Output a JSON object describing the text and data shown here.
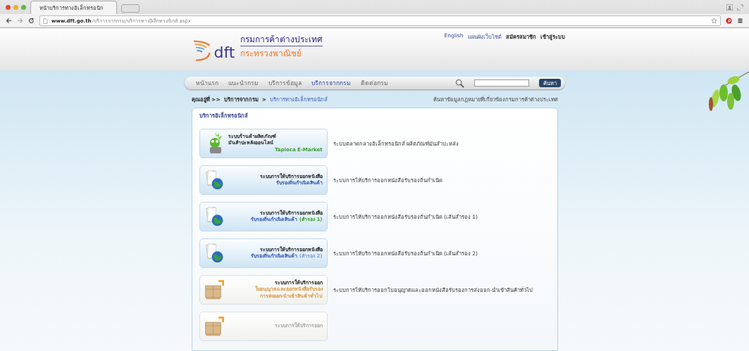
{
  "browser": {
    "tab_title": "หน้าบริการทางอิเล็กทรอนิก",
    "url_host": "www.dft.go.th",
    "url_path": "/บริการจากกรม/บริการทางอิเล็กทรอนิกส์.aspx"
  },
  "header": {
    "top_links": [
      "English",
      "แผนผังเว็บไซต์",
      "สมัครสมาชิก",
      "เข้าสู่ระบบ"
    ],
    "logo_mark": "dft",
    "org_name": "กรมการค้าต่างประเทศ",
    "ministry": "กระทรวงพาณิชย์"
  },
  "nav": {
    "items": [
      {
        "label": "หน้าแรก",
        "selected": false
      },
      {
        "label": "แนะนำกรม",
        "selected": false
      },
      {
        "label": "บริการข้อมูล",
        "selected": false
      },
      {
        "label": "บริการจากกรม",
        "selected": true
      },
      {
        "label": "ติดต่อกรม",
        "selected": false
      }
    ],
    "search_button": "ค้นหา"
  },
  "breadcrumb": {
    "prefix": "คุณอยู่ที่ >>",
    "items": [
      "บริการจากกรม",
      "บริการทางอิเล็กทรอนิกส์"
    ],
    "separator": ">",
    "right_link": "ค้นหาข้อมูลกฎหมายที่เกี่ยวข้องกรมการค้าต่างประเทศ"
  },
  "panel": {
    "title": "บริการอิเล็กทรอนิกส์",
    "services": [
      {
        "kind": "mascot",
        "lines": [
          [
            {
              "text": "ระบบร้านค้าผลิตภัณฑ์",
              "color": "#222222"
            }
          ],
          [
            {
              "text": "มันสำปะหลังออนไลน์",
              "color": "#222222"
            }
          ],
          [
            {
              "text": "Tapioca E-Market",
              "color": "#3a9a2a"
            }
          ]
        ],
        "description": "ระบบตลาดกลางอิเล็กทรอนิกส์ ผลิตภัณฑ์มันสำปะหลัง"
      },
      {
        "kind": "globe",
        "lines": [
          [
            {
              "text": "ระบบการให้บริการออกหนังสือ",
              "color": "#222222"
            }
          ],
          [
            {
              "text": "รับรองถิ่นกำเนิดสินค้า",
              "color": "#2b52b0"
            }
          ]
        ],
        "description": "ระบบการให้บริการออกหนังสือรับรองถิ่นกำเนิด"
      },
      {
        "kind": "globe",
        "lines": [
          [
            {
              "text": "ระบบการให้บริการออกหนังสือ",
              "color": "#222222"
            }
          ],
          [
            {
              "text": "รับรองถิ่นกำเนิดสินค้า",
              "color": "#2b52b0"
            },
            {
              "text": "(สำรอง 1)",
              "color": "#3a9a2a"
            }
          ]
        ],
        "description": "ระบบการให้บริการออกหนังสือรับรองถิ่นกำเนิด (เส้นสำรอง 1)"
      },
      {
        "kind": "globe",
        "lines": [
          [
            {
              "text": "ระบบการให้บริการออกหนังสือ",
              "color": "#222222"
            }
          ],
          [
            {
              "text": "รับรองถิ่นกำเนิดสินค้า",
              "color": "#2b52b0"
            },
            {
              "text": "(สำรอง 2)",
              "color": "#7a9acf"
            }
          ]
        ],
        "description": "ระบบการให้บริการออกหนังสือรับรองถิ่นกำเนิด (เส้นสำรอง 2)"
      },
      {
        "kind": "box",
        "lines": [
          [
            {
              "text": "ระบบการให้บริการออก",
              "color": "#222222"
            }
          ],
          [
            {
              "text": "ใบอนุญาตและออกหนังสือรับรอง",
              "color": "#d9963a"
            }
          ],
          [
            {
              "text": "การส่งออก-นำเข้าสินค้าทั่วไป",
              "color": "#d9963a"
            }
          ]
        ],
        "description": "ระบบการให้บริการออกใบอนุญาตและออกหนังสือรับรองการส่งออก-นำเข้าสินค้าทั่วไป"
      },
      {
        "kind": "box",
        "lines": [
          [
            {
              "text": "ระบบการให้บริการออก",
              "color": "#aaaaaa"
            }
          ]
        ]
      }
    ]
  }
}
